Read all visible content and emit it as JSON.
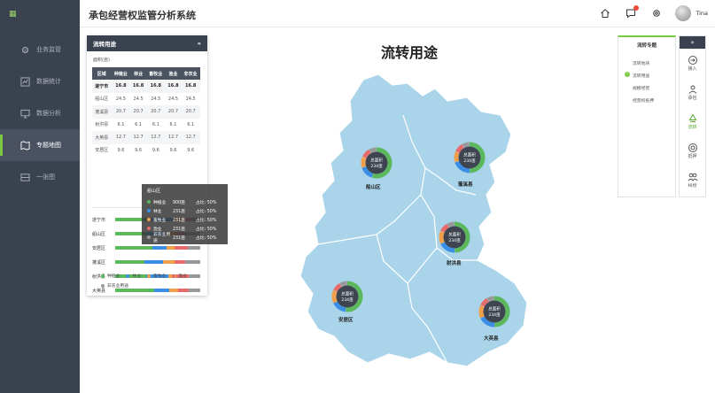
{
  "app": {
    "title": "承包经营权监管分析系统",
    "user": "Tina"
  },
  "sidebar": {
    "items": [
      {
        "label": "业务监管",
        "icon": "gear-icon"
      },
      {
        "label": "数据统计",
        "icon": "stats-icon"
      },
      {
        "label": "数据分析",
        "icon": "monitor-icon"
      },
      {
        "label": "专题地图",
        "icon": "map-icon"
      },
      {
        "label": "一张图",
        "icon": "layers-icon"
      }
    ],
    "active_index": 3
  },
  "map": {
    "title": "流转用途",
    "donut_center_line1": "总面积",
    "donut_center_line2": "234亩",
    "regions": [
      {
        "name": "船山区",
        "shares": [
          0.55,
          0.15,
          0.12,
          0.1,
          0.08
        ]
      },
      {
        "name": "蓬溪县",
        "shares": [
          0.5,
          0.2,
          0.12,
          0.1,
          0.08
        ]
      },
      {
        "name": "射洪县",
        "shares": [
          0.5,
          0.18,
          0.14,
          0.1,
          0.08
        ]
      },
      {
        "name": "安居区",
        "shares": [
          0.52,
          0.16,
          0.14,
          0.1,
          0.08
        ]
      },
      {
        "name": "大英县",
        "shares": [
          0.5,
          0.18,
          0.14,
          0.1,
          0.08
        ]
      }
    ]
  },
  "panel": {
    "title": "流转用途",
    "unit": "面积(亩)",
    "columns": [
      "区域",
      "种植业",
      "林业",
      "畜牧业",
      "渔业",
      "非农业"
    ],
    "rows": [
      [
        "遂宁市",
        "16.8",
        "16.8",
        "16.8",
        "16.8",
        "16.8"
      ],
      [
        "船山区",
        "24.5",
        "24.5",
        "24.5",
        "24.5",
        "24.5"
      ],
      [
        "蓬溪县",
        "20.7",
        "20.7",
        "20.7",
        "20.7",
        "20.7"
      ],
      [
        "射洪县",
        "6.1",
        "6.1",
        "6.1",
        "6.1",
        "6.1"
      ],
      [
        "大英县",
        "12.7",
        "12.7",
        "12.7",
        "12.7",
        "12.7"
      ],
      [
        "安居区",
        "9.6",
        "9.6",
        "9.6",
        "9.6",
        "9.6"
      ]
    ],
    "bars": [
      {
        "label": "遂宁市",
        "shares": [
          0.42,
          0.28,
          0.08,
          0.1,
          0.12
        ]
      },
      {
        "label": "船山区",
        "shares": [
          0.38,
          0.24,
          0.08,
          0.12,
          0.18
        ]
      },
      {
        "label": "安居区",
        "shares": [
          0.44,
          0.16,
          0.1,
          0.15,
          0.15
        ]
      },
      {
        "label": "蓬溪区",
        "shares": [
          0.34,
          0.22,
          0.14,
          0.12,
          0.18
        ]
      },
      {
        "label": "射洪县",
        "shares": [
          0.36,
          0.26,
          0.1,
          0.14,
          0.14
        ]
      },
      {
        "label": "大英县",
        "shares": [
          0.46,
          0.18,
          0.1,
          0.12,
          0.14
        ]
      }
    ],
    "legend": [
      "种植业",
      "林业",
      "畜牧业",
      "渔业",
      "非农业用途"
    ]
  },
  "tooltip": {
    "title": "船山区",
    "rows": [
      {
        "name": "种植业",
        "value": "900亩",
        "share": "占比: 50%"
      },
      {
        "name": "林业",
        "value": "231亩",
        "share": "占比: 50%"
      },
      {
        "name": "畜牧业",
        "value": "231亩",
        "share": "占比: 50%"
      },
      {
        "name": "渔业",
        "value": "231亩",
        "share": "占比: 50%"
      },
      {
        "name": "非农业用途",
        "value": "231亩",
        "share": "占比: 50%"
      }
    ]
  },
  "topics": {
    "title": "流转专题",
    "items": [
      "流转地块",
      "流转用途",
      "规模经营",
      "经营权抵押"
    ],
    "active_index": 1
  },
  "tools": [
    {
      "label": "接入",
      "icon": "login-icon"
    },
    {
      "label": "承包",
      "icon": "users-icon"
    },
    {
      "label": "流转",
      "icon": "recycle-icon"
    },
    {
      "label": "抵押",
      "icon": "coin-icon"
    },
    {
      "label": "纠纷",
      "icon": "people-icon"
    }
  ],
  "colors": {
    "accent": "#7ac943",
    "series": [
      "#5cb85c",
      "#3a8ee6",
      "#f0a04b",
      "#e86a6a",
      "#999999"
    ],
    "map_fill": "#a9d4ea",
    "sidebar_bg": "#3a4250"
  }
}
